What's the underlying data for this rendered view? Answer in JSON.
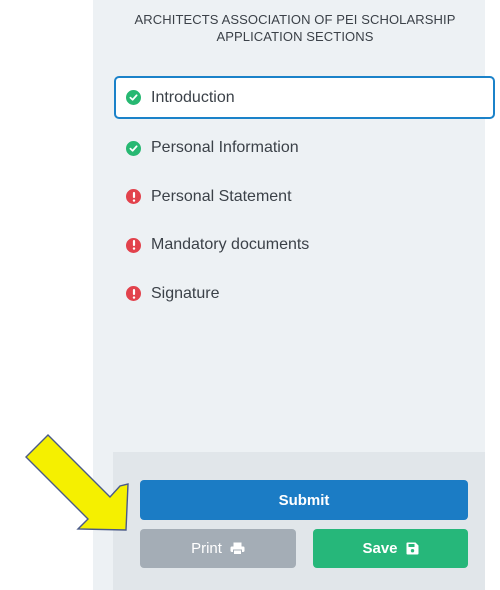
{
  "panel": {
    "title_line1": "ARCHITECTS ASSOCIATION OF PEI SCHOLARSHIP",
    "title_line2": "APPLICATION SECTIONS"
  },
  "sections": [
    {
      "label": "Introduction",
      "status": "complete",
      "active": true
    },
    {
      "label": "Personal Information",
      "status": "complete",
      "active": false
    },
    {
      "label": "Personal Statement",
      "status": "incomplete",
      "active": false
    },
    {
      "label": "Mandatory documents",
      "status": "incomplete",
      "active": false
    },
    {
      "label": "Signature",
      "status": "incomplete",
      "active": false
    }
  ],
  "actions": {
    "submit_label": "Submit",
    "print_label": "Print",
    "print_icon": "printer-icon",
    "save_label": "Save",
    "save_icon": "floppy-disk-icon"
  },
  "annotation": {
    "arrow_icon": "yellow-arrow-icon",
    "arrow_color": "#f5f000"
  },
  "colors": {
    "complete": "#27b872",
    "incomplete": "#e2424c",
    "active_border": "#1b82c9",
    "submit": "#1b7cc5",
    "print": "#a4adb6",
    "save": "#26b77a"
  }
}
